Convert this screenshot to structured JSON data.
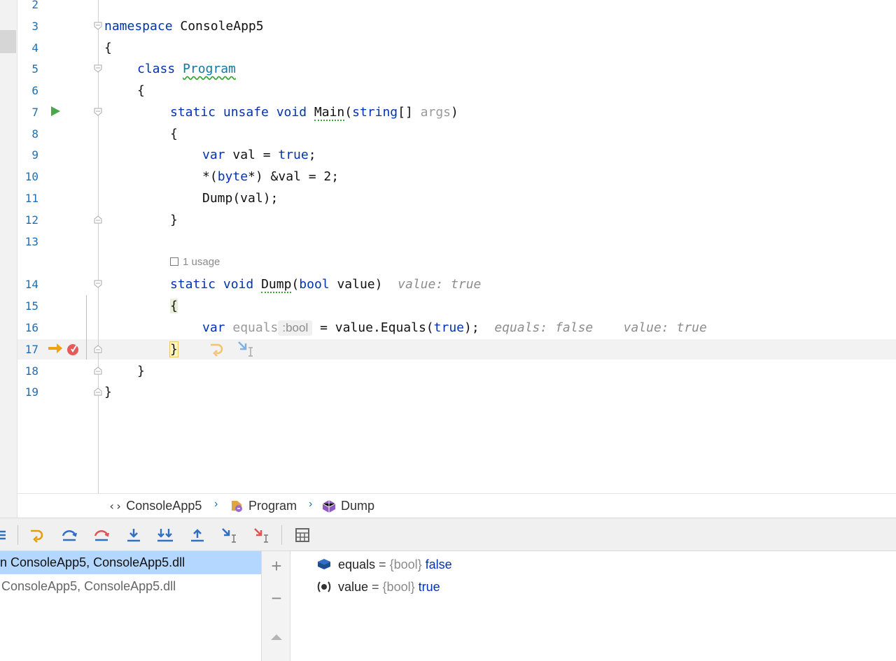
{
  "editor": {
    "lines": [
      {
        "n": "2"
      },
      {
        "n": "3"
      },
      {
        "n": "4"
      },
      {
        "n": "5"
      },
      {
        "n": "6"
      },
      {
        "n": "7"
      },
      {
        "n": "8"
      },
      {
        "n": "9"
      },
      {
        "n": "10"
      },
      {
        "n": "11"
      },
      {
        "n": "12"
      },
      {
        "n": "13"
      },
      {
        "n": "14"
      },
      {
        "n": "15"
      },
      {
        "n": "16"
      },
      {
        "n": "17"
      },
      {
        "n": "18"
      },
      {
        "n": "19"
      }
    ],
    "code": {
      "l3_kw": "namespace",
      "l3_name": " ConsoleApp5",
      "l4": "{",
      "l5_kw": "class",
      "l5_name": "Program",
      "l6": "{",
      "l7_kw": "static unsafe void",
      "l7_main": "Main",
      "l7_open": "(",
      "l7_type": "string",
      "l7_arr": "[] ",
      "l7_param": "args",
      "l7_close": ")",
      "l8": "{",
      "l9_var": "var",
      "l9_rest": " val = ",
      "l9_true": "true",
      "l9_end": ";",
      "l10_a": "*(",
      "l10_byte": "byte",
      "l10_b": "*) &val = 2;",
      "l11": "Dump(val);",
      "l12": "}",
      "usage": "1 usage",
      "l14_kw": "static void",
      "l14_dump": "Dump",
      "l14_open": "(",
      "l14_bool": "bool",
      "l14_rest": " value)",
      "l14_hint": "value: true",
      "l15": "{",
      "l16_var": "var",
      "l16_name": " equals",
      "l16_type": ":bool",
      "l16_rest": " = value.Equals(",
      "l16_true": "true",
      "l16_end": ");",
      "l16_hint1": "equals: false",
      "l16_hint2": "value: true",
      "l17": "}",
      "l18": "}",
      "l19": "}"
    }
  },
  "breadcrumb": {
    "items": [
      "ConsoleApp5",
      "Program",
      "Dump"
    ]
  },
  "frames": {
    "items": [
      {
        "label": "n ConsoleApp5, ConsoleApp5.dll"
      },
      {
        "label": "ConsoleApp5, ConsoleApp5.dll"
      }
    ]
  },
  "variables": {
    "items": [
      {
        "name": "equals",
        "eq": " = ",
        "type": "{bool}",
        "value": "false"
      },
      {
        "name": "value",
        "eq": " = ",
        "type": "{bool}",
        "value": "true"
      }
    ]
  },
  "sidebar": {
    "add": "+",
    "remove": "−"
  },
  "colors": {
    "keyword": "#0033b3",
    "line_number": "#1f6fb2",
    "selection": "#b4d7ff",
    "exec_arrow": "#f0a30a",
    "run": "#4ca64c"
  }
}
